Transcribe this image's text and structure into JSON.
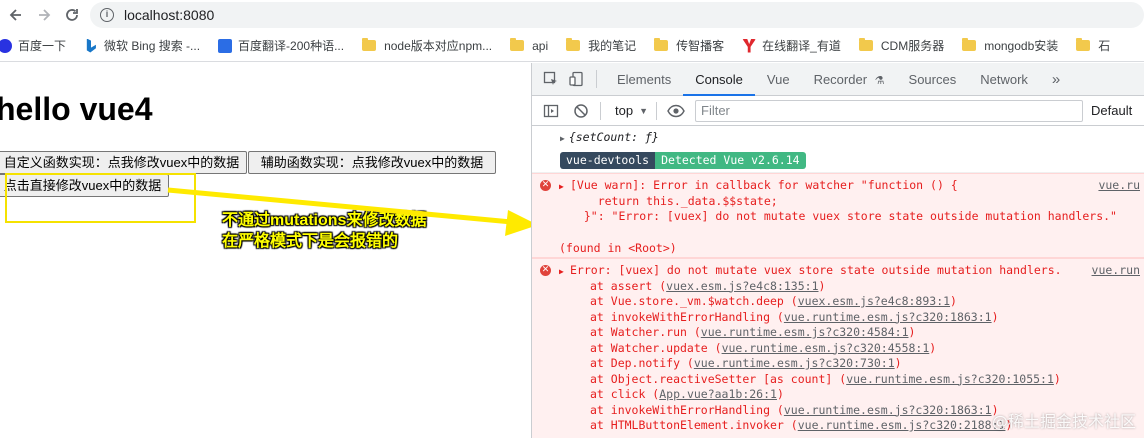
{
  "browser": {
    "url": "localhost:8080"
  },
  "bookmarks": [
    {
      "label": "百度一下",
      "icon": "baidu-icon"
    },
    {
      "label": "微软 Bing 搜索 -...",
      "icon": "bing-icon"
    },
    {
      "label": "百度翻译-200种语...",
      "icon": "translate-icon"
    },
    {
      "label": "node版本对应npm...",
      "icon": "folder-icon"
    },
    {
      "label": "api",
      "icon": "folder-icon"
    },
    {
      "label": "我的笔记",
      "icon": "folder-icon"
    },
    {
      "label": "传智播客",
      "icon": "folder-icon"
    },
    {
      "label": "在线翻译_有道",
      "icon": "youdao-icon"
    },
    {
      "label": "CDM服务器",
      "icon": "folder-icon"
    },
    {
      "label": "mongodb安装",
      "icon": "folder-icon"
    },
    {
      "label": "石",
      "icon": "folder-icon"
    }
  ],
  "page": {
    "heading": "hello vue4",
    "btn_custom": "自定义函数实现：点我修改vuex中的数据",
    "btn_helper": "辅助函数实现：点我修改vuex中的数据",
    "btn_direct": "点击直接修改vuex中的数据",
    "annotation_line1": "不通过mutations来修改数据",
    "annotation_line2": "在严格模式下是会报错的"
  },
  "devtools": {
    "tabs": [
      "Elements",
      "Console",
      "Vue",
      "Recorder",
      "Sources",
      "Network"
    ],
    "active_tab": "Console",
    "context": "top",
    "filter_placeholder": "Filter",
    "levels_label": "Default",
    "more_tabs": "»",
    "log_object": "{setCount: ƒ}",
    "badge_left": "vue-devtools",
    "badge_right": "Detected Vue v2.6.14",
    "warn_lines": [
      "[Vue warn]: Error in callback for watcher \"function () {",
      "    return this._data.$$state;",
      "  }\": \"Error: [vuex] do not mutate vuex store state outside mutation handlers.\"",
      "",
      "(found in <Root>)"
    ],
    "warn_source": "vue.ru",
    "error_head": "Error: [vuex] do not mutate vuex store state outside mutation handlers.",
    "error_source": "vue.run",
    "stack": [
      {
        "fn": "at assert (",
        "link": "vuex.esm.js?e4c8:135:1",
        "end": ")"
      },
      {
        "fn": "at Vue.store._vm.$watch.deep (",
        "link": "vuex.esm.js?e4c8:893:1",
        "end": ")"
      },
      {
        "fn": "at invokeWithErrorHandling (",
        "link": "vue.runtime.esm.js?c320:1863:1",
        "end": ")"
      },
      {
        "fn": "at Watcher.run (",
        "link": "vue.runtime.esm.js?c320:4584:1",
        "end": ")"
      },
      {
        "fn": "at Watcher.update (",
        "link": "vue.runtime.esm.js?c320:4558:1",
        "end": ")"
      },
      {
        "fn": "at Dep.notify (",
        "link": "vue.runtime.esm.js?c320:730:1",
        "end": ")"
      },
      {
        "fn": "at Object.reactiveSetter [as count] (",
        "link": "vue.runtime.esm.js?c320:1055:1",
        "end": ")"
      },
      {
        "fn": "at click (",
        "link": "App.vue?aa1b:26:1",
        "end": ")"
      },
      {
        "fn": "at invokeWithErrorHandling (",
        "link": "vue.runtime.esm.js?c320:1863:1",
        "end": ")"
      },
      {
        "fn": "at HTMLButtonElement.invoker (",
        "link": "vue.runtime.esm.js?c320:2188:1",
        "end": ")"
      }
    ],
    "watermark": "@稀土掘金技术社区"
  },
  "colors": {
    "error_text": "#e61e1e",
    "error_bg": "#fff0f0",
    "accent": "#1a73e8",
    "vue_green": "#41b883",
    "vue_dark": "#35495e",
    "annotation": "#ffff00"
  }
}
